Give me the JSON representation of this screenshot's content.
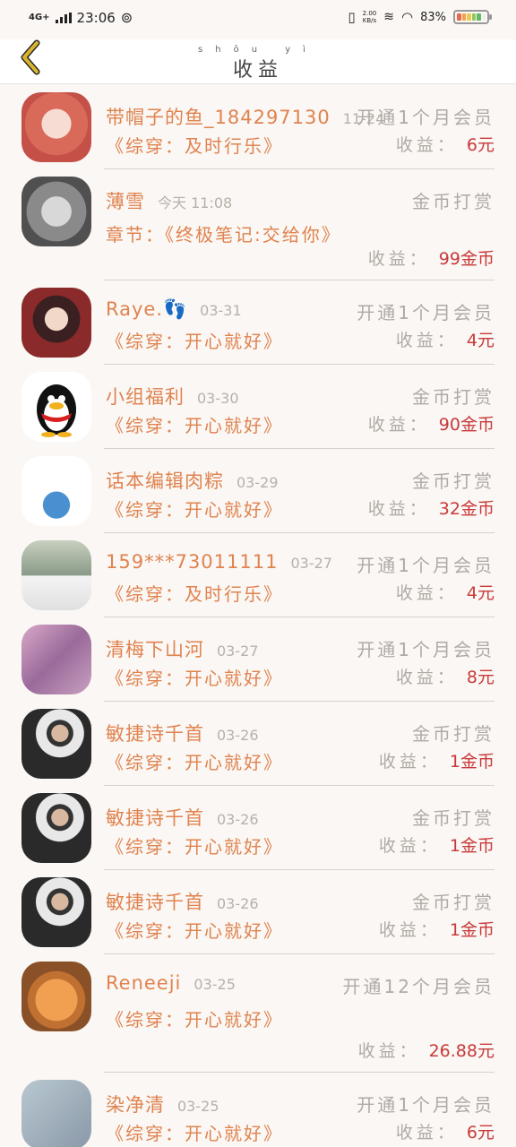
{
  "status": {
    "network": "4G+",
    "time": "23:06",
    "speed_top": "2.00",
    "speed_bottom": "KB/s",
    "battery": "83%"
  },
  "header": {
    "title": "收益",
    "title_pinyin": "shōu yì"
  },
  "colors": {
    "accent": "#e0834f",
    "income": "#c83a3a",
    "muted": "#b0aaa4"
  },
  "rows": [
    {
      "name": "带帽子的鱼_184297130",
      "date": "11-24",
      "reward": "开通1个月会员",
      "book": "《综穿：及时行乐》",
      "income_label": "收益：",
      "income_value": "6",
      "unit": "元",
      "avatar": "girl-pink-hair"
    },
    {
      "name": "薄雪",
      "date": "今天 11:08",
      "reward": "金币打赏",
      "book": "章节：《终极笔记:交给你》",
      "income_label": "收益：",
      "income_value": "99",
      "unit": "金币",
      "avatar": "cat"
    },
    {
      "name": "Raye.👣",
      "date": "03-31",
      "reward": "开通1个月会员",
      "book": "《综穿：开心就好》",
      "income_label": "收益：",
      "income_value": "4",
      "unit": "元",
      "avatar": "anime-girl"
    },
    {
      "name": "小组福利",
      "date": "03-30",
      "reward": "金币打赏",
      "book": "《综穿：开心就好》",
      "income_label": "收益：",
      "income_value": "90",
      "unit": "金币",
      "avatar": "penguin"
    },
    {
      "name": "话本编辑肉粽",
      "date": "03-29",
      "reward": "金币打赏",
      "book": "《综穿：开心就好》",
      "income_label": "收益：",
      "income_value": "32",
      "unit": "金币",
      "avatar": "earth"
    },
    {
      "name": "159***73011111",
      "date": "03-27",
      "reward": "开通1个月会员",
      "book": "《综穿：及时行乐》",
      "income_label": "收益：",
      "income_value": "4",
      "unit": "元",
      "avatar": "wedding"
    },
    {
      "name": "清梅下山河",
      "date": "03-27",
      "reward": "开通1个月会员",
      "book": "《综穿：开心就好》",
      "income_label": "收益：",
      "income_value": "8",
      "unit": "元",
      "avatar": "purple-girl"
    },
    {
      "name": "敏捷诗千首",
      "date": "03-26",
      "reward": "金币打赏",
      "book": "《综穿：开心就好》",
      "income_label": "收益：",
      "income_value": "1",
      "unit": "金币",
      "avatar": "man-camera"
    },
    {
      "name": "敏捷诗千首",
      "date": "03-26",
      "reward": "金币打赏",
      "book": "《综穿：开心就好》",
      "income_label": "收益：",
      "income_value": "1",
      "unit": "金币",
      "avatar": "man-camera"
    },
    {
      "name": "敏捷诗千首",
      "date": "03-26",
      "reward": "金币打赏",
      "book": "《综穿：开心就好》",
      "income_label": "收益：",
      "income_value": "1",
      "unit": "金币",
      "avatar": "man-camera"
    },
    {
      "name": "Reneeji",
      "date": "03-25",
      "reward": "开通12个月会员",
      "book": "《综穿：开心就好》",
      "income_label": "收益：",
      "income_value": "26.88",
      "unit": "元",
      "avatar": "dog"
    },
    {
      "name": "染净清",
      "date": "03-25",
      "reward": "开通1个月会员",
      "book": "《综穿：开心就好》",
      "income_label": "收益：",
      "income_value": "6",
      "unit": "元",
      "avatar": "blurry"
    }
  ]
}
